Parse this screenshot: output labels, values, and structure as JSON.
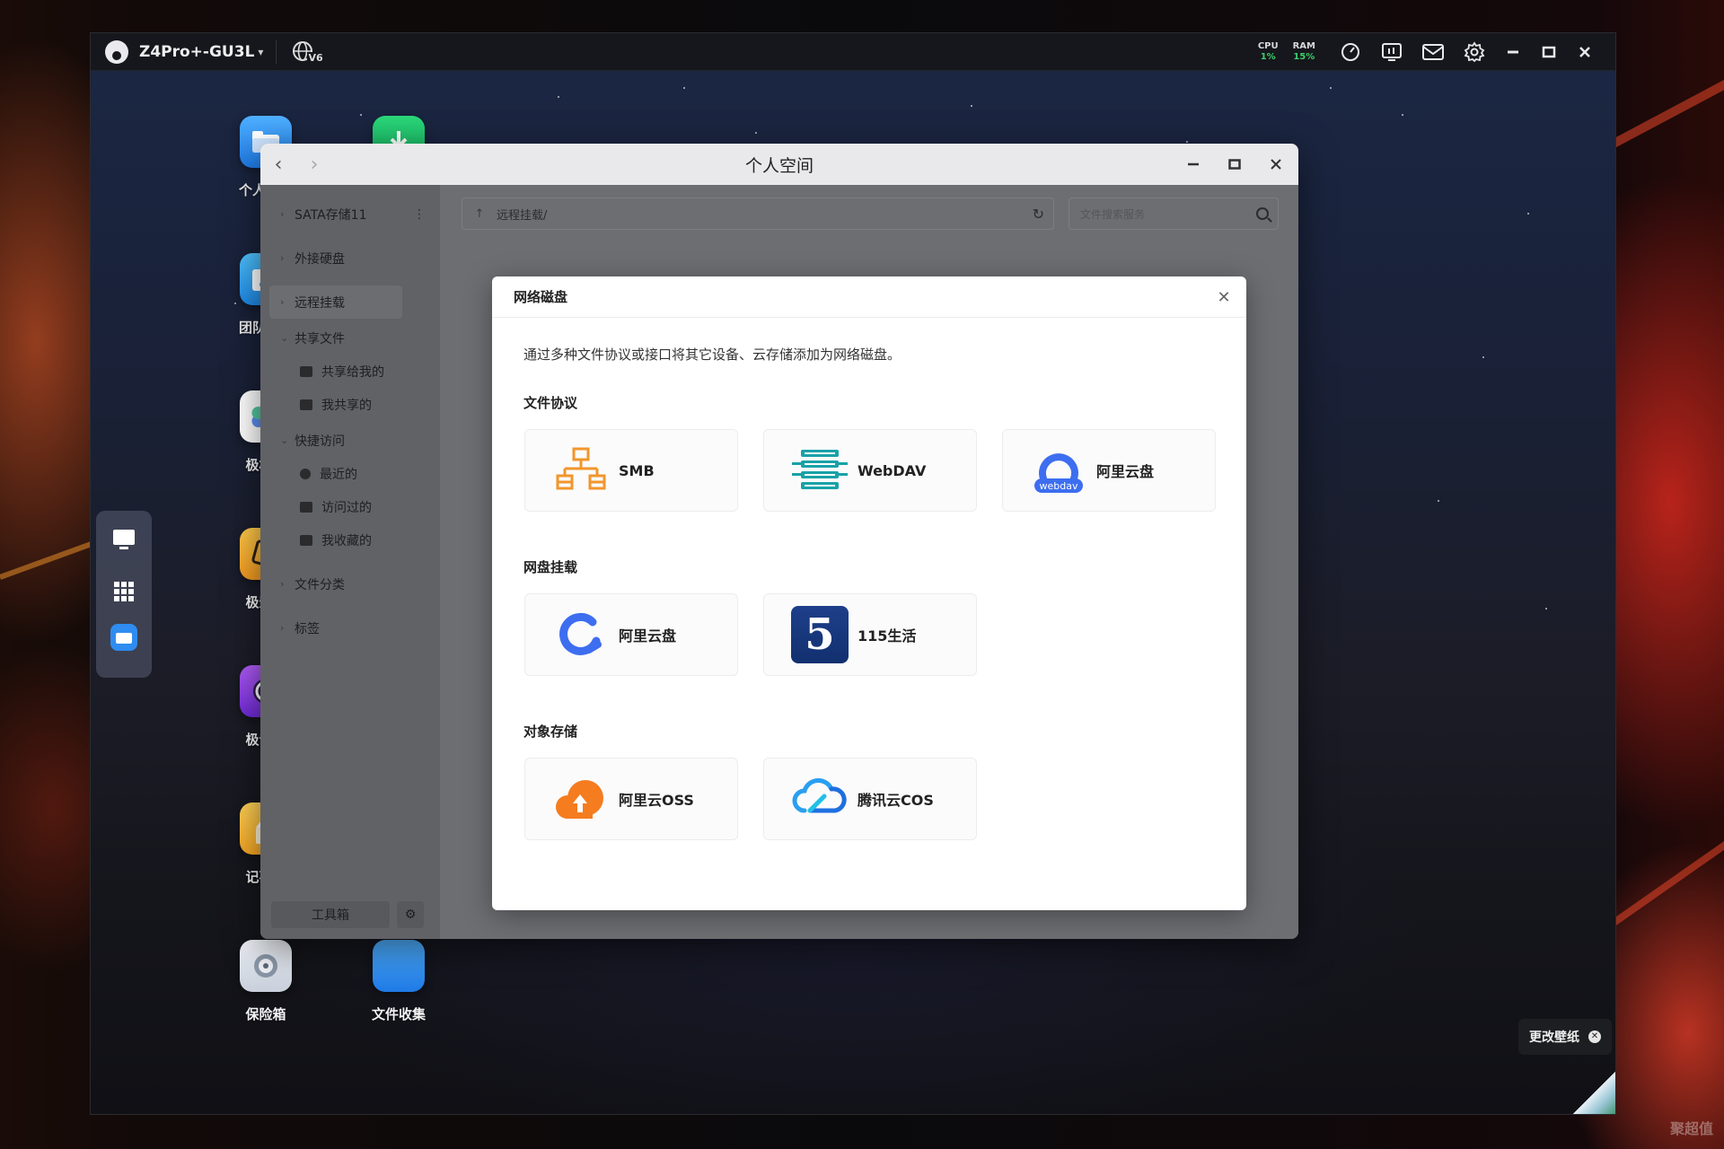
{
  "topbar": {
    "device_name": "Z4Pro+-GU3L",
    "network_badge": "V6",
    "cpu": {
      "label": "CPU",
      "value": "1%"
    },
    "ram": {
      "label": "RAM",
      "value": "15%"
    },
    "icons": [
      "speedometer-icon",
      "monitor-icon",
      "mail-icon",
      "gear-icon",
      "minimize-icon",
      "maximize-icon",
      "close-icon"
    ]
  },
  "desktop_apps": [
    {
      "label": "个人空间",
      "icon": "folder-icon",
      "color": "#2f8cf0"
    },
    {
      "label": "团队空间",
      "icon": "team-folder-icon",
      "color": "#2aa0f5"
    },
    {
      "label": "极相册",
      "icon": "photos-icon",
      "color": "#ffffff"
    },
    {
      "label": "极影视",
      "icon": "video-icon",
      "color": "#f5a623"
    },
    {
      "label": "极音乐",
      "icon": "music-icon",
      "color": "#8e3fe0"
    },
    {
      "label": "记事本",
      "icon": "notepad-icon",
      "color": "#f7b733"
    },
    {
      "label": "保险箱",
      "icon": "safe-icon",
      "color": "#dfe3ea"
    },
    {
      "label": "",
      "icon": "download-icon",
      "color": "#18c06a"
    },
    {
      "label": "文件收集",
      "icon": "file-collect-icon",
      "color": "#2f8cf0"
    }
  ],
  "wallpaper": {
    "label": "更改壁纸"
  },
  "file_manager": {
    "title": "个人空间",
    "sidebar": [
      {
        "label": "SATA存储11",
        "type": "group"
      },
      {
        "label": "外接硬盘",
        "type": "group"
      },
      {
        "label": "远程挂载",
        "type": "group-active"
      },
      {
        "label": "共享文件",
        "type": "group-open"
      },
      {
        "label": "共享给我的",
        "type": "sub"
      },
      {
        "label": "我共享的",
        "type": "sub"
      },
      {
        "label": "快捷访问",
        "type": "group-open"
      },
      {
        "label": "最近的",
        "type": "sub"
      },
      {
        "label": "访问过的",
        "type": "sub"
      },
      {
        "label": "我收藏的",
        "type": "sub"
      },
      {
        "label": "文件分类",
        "type": "group"
      },
      {
        "label": "标签",
        "type": "group"
      }
    ],
    "toolbox_label": "工具箱",
    "path": "远程挂载/",
    "search_placeholder": "文件搜索服务"
  },
  "dialog": {
    "title": "网络磁盘",
    "description": "通过多种文件协议或接口将其它设备、云存储添加为网络磁盘。",
    "sections": [
      {
        "title": "文件协议",
        "items": [
          {
            "label": "SMB",
            "icon": "smb-network-icon"
          },
          {
            "label": "WebDAV",
            "icon": "webdav-server-icon"
          },
          {
            "label": "阿里云盘",
            "icon": "aliyun-webdav-icon"
          }
        ]
      },
      {
        "title": "网盘挂载",
        "items": [
          {
            "label": "阿里云盘",
            "icon": "aliyun-drive-icon"
          },
          {
            "label": "115生活",
            "icon": "115-icon"
          }
        ]
      },
      {
        "title": "对象存储",
        "items": [
          {
            "label": "阿里云OSS",
            "icon": "aliyun-oss-icon"
          },
          {
            "label": "腾讯云COS",
            "icon": "tencent-cos-icon"
          }
        ]
      }
    ]
  },
  "badges": {
    "webdav_text": "webdav",
    "digit_115": "5"
  },
  "watermark": "聚超值"
}
